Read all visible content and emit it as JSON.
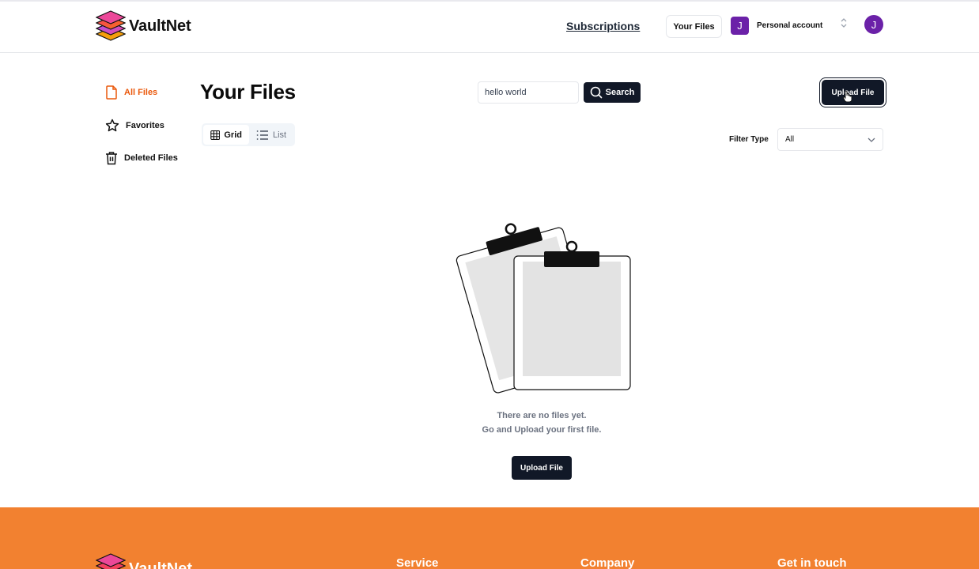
{
  "app": {
    "name": "VaultNet"
  },
  "nav": {
    "subscriptions": "Subscriptions",
    "your_files": "Your Files",
    "org_initial": "J",
    "org_label": "Personal account",
    "user_initial": "J"
  },
  "sidebar": {
    "items": [
      {
        "label": "All Files",
        "icon": "file-icon",
        "active": true
      },
      {
        "label": "Favorites",
        "icon": "star-icon",
        "active": false
      },
      {
        "label": "Deleted Files",
        "icon": "trash-icon",
        "active": false
      }
    ]
  },
  "main": {
    "title": "Your Files",
    "search_value": "hello world",
    "search_label": "Search",
    "upload_label": "Upload File",
    "tabs": [
      {
        "label": "Grid",
        "icon": "grid-icon",
        "active": true
      },
      {
        "label": "List",
        "icon": "list-icon",
        "active": false
      }
    ],
    "filter_label": "Filter Type",
    "filter_value": "All"
  },
  "empty": {
    "line1": "There are no files yet.",
    "line2": "Go and Upload your first file.",
    "upload_label": "Upload File"
  },
  "footer": {
    "brand": "VaultNet",
    "headings": [
      "Service",
      "Company",
      "Get in touch"
    ]
  },
  "colors": {
    "accent": "#ea580c",
    "primary_button": "#111827",
    "avatar": "#6b21a8",
    "footer": "#f28130"
  }
}
